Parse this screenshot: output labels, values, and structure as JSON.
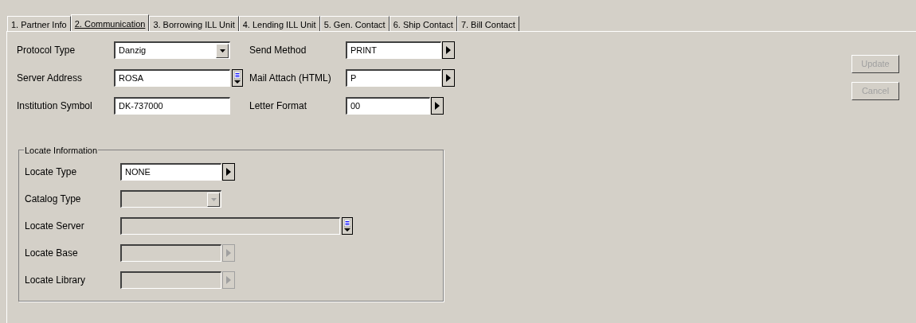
{
  "tabs": [
    {
      "label": "1. Partner Info",
      "selected": false
    },
    {
      "label": "2. Communication",
      "selected": true
    },
    {
      "label": "3. Borrowing ILL Unit",
      "selected": false
    },
    {
      "label": "4. Lending ILL Unit",
      "selected": false
    },
    {
      "label": "5. Gen. Contact",
      "selected": false
    },
    {
      "label": "6. Ship Contact",
      "selected": false
    },
    {
      "label": "7. Bill Contact",
      "selected": false
    }
  ],
  "fields_left": [
    {
      "label": "Protocol Type",
      "value": "Danzig",
      "kind": "dropdown",
      "disabled": false
    },
    {
      "label": "Server Address",
      "value": "ROSA",
      "kind": "list",
      "disabled": false
    },
    {
      "label": "Institution Symbol",
      "value": "DK-737000",
      "kind": "text",
      "disabled": false
    }
  ],
  "fields_right": [
    {
      "label": "Send Method",
      "value": "PRINT",
      "kind": "arrow",
      "disabled": false
    },
    {
      "label": "Mail Attach (HTML)",
      "value": "P",
      "kind": "arrow",
      "disabled": false
    },
    {
      "label": "Letter Format",
      "value": "00",
      "kind": "arrow_short",
      "disabled": false
    }
  ],
  "locate": {
    "title": "Locate Information",
    "fields": [
      {
        "label": "Locate Type",
        "value": "NONE",
        "kind": "arrow",
        "disabled": false
      },
      {
        "label": "Catalog Type",
        "kind": "dropdown",
        "disabled": true
      },
      {
        "label": "Locate Server",
        "kind": "list_wide",
        "disabled": true
      },
      {
        "label": "Locate Base",
        "kind": "arrow",
        "disabled": true
      },
      {
        "label": "Locate Library",
        "kind": "arrow",
        "disabled": true
      }
    ]
  },
  "buttons": [
    {
      "label": "Update",
      "disabled": true
    },
    {
      "label": "Cancel",
      "disabled": true
    }
  ]
}
